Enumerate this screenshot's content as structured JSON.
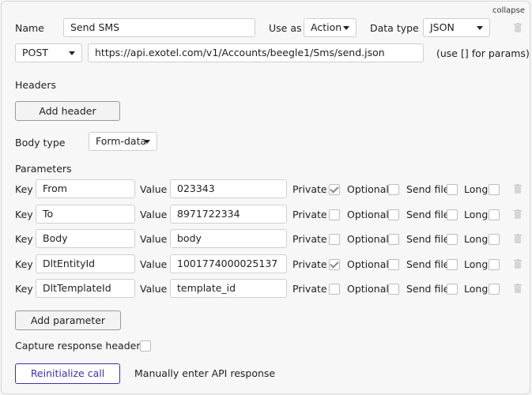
{
  "header": {
    "collapse_label": "collapse"
  },
  "call": {
    "name_label": "Name",
    "name_value": "Send SMS",
    "use_as_label": "Use as",
    "use_as_value": "Action",
    "data_type_label": "Data type",
    "data_type_value": "JSON",
    "method_value": "POST",
    "url_value": "https://api.exotel.com/v1/Accounts/beegle1/Sms/send.json",
    "params_hint": "(use [] for params)"
  },
  "headers": {
    "title": "Headers",
    "add_label": "Add header"
  },
  "body": {
    "type_label": "Body type",
    "type_value": "Form-data"
  },
  "parameters": {
    "title": "Parameters",
    "key_label": "Key",
    "value_label": "Value",
    "private_label": "Private",
    "optional_label": "Optional",
    "send_file_label": "Send file",
    "long_label": "Long",
    "rows": [
      {
        "key": "From",
        "value": "023343",
        "private": true,
        "optional": false,
        "send_file": false,
        "long": false
      },
      {
        "key": "To",
        "value": "8971722334",
        "private": false,
        "optional": false,
        "send_file": false,
        "long": false
      },
      {
        "key": "Body",
        "value": "body",
        "private": false,
        "optional": false,
        "send_file": false,
        "long": false
      },
      {
        "key": "DltEntityId",
        "value": "1001774000025137",
        "private": true,
        "optional": false,
        "send_file": false,
        "long": false
      },
      {
        "key": "DltTemplateId",
        "value": "template_id",
        "private": false,
        "optional": false,
        "send_file": false,
        "long": false
      }
    ],
    "add_label": "Add parameter"
  },
  "capture": {
    "label": "Capture response headers",
    "checked": false
  },
  "footer": {
    "reinitialize_label": "Reinitialize call",
    "manual_label": "Manually enter API response"
  }
}
